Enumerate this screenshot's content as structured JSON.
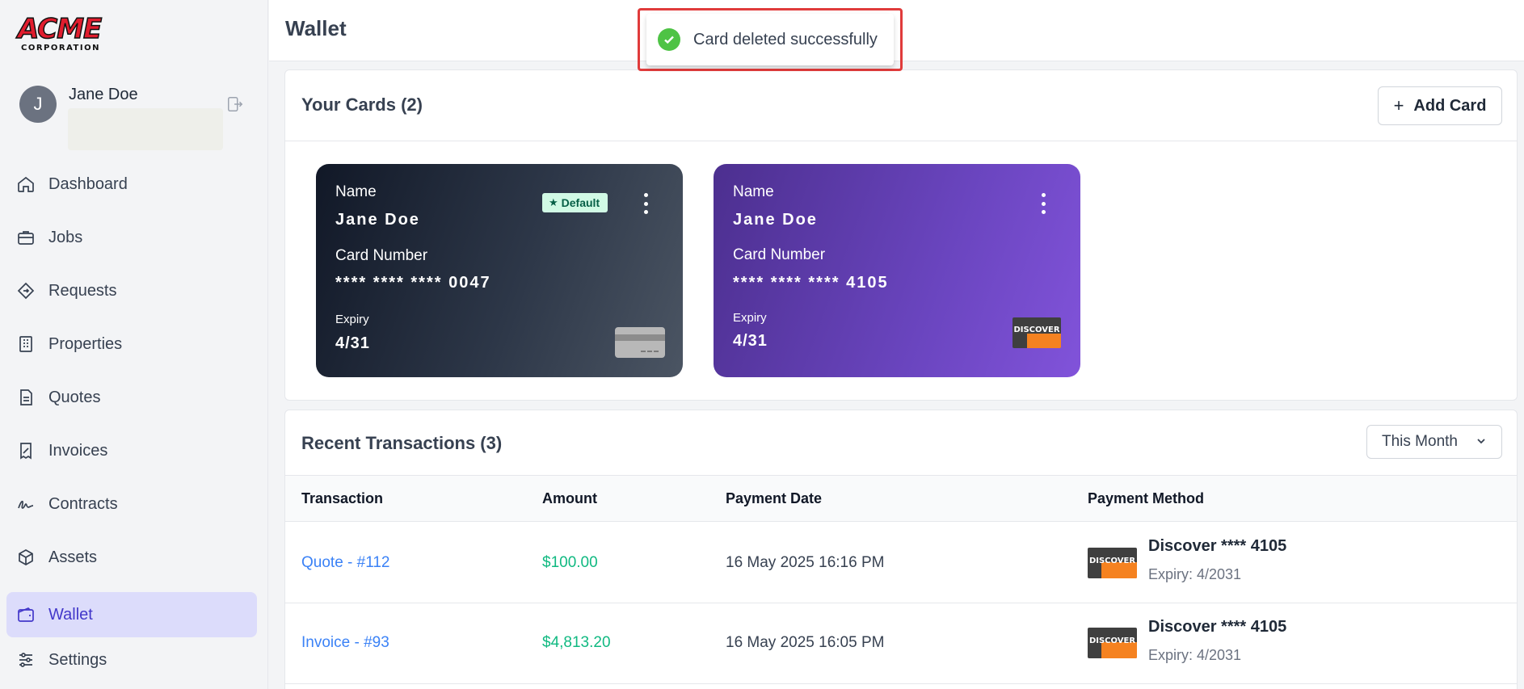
{
  "sidebar": {
    "logo": {
      "line1": "ACME",
      "line2": "CORPORATION"
    },
    "user": {
      "initial": "J",
      "name": "Jane Doe"
    },
    "items": [
      {
        "label": "Dashboard",
        "icon": "home-icon"
      },
      {
        "label": "Jobs",
        "icon": "briefcase-icon"
      },
      {
        "label": "Requests",
        "icon": "diamond-icon"
      },
      {
        "label": "Properties",
        "icon": "building-icon"
      },
      {
        "label": "Quotes",
        "icon": "document-icon"
      },
      {
        "label": "Invoices",
        "icon": "receipt-icon"
      },
      {
        "label": "Contracts",
        "icon": "signature-icon"
      },
      {
        "label": "Assets",
        "icon": "cube-icon"
      },
      {
        "label": "Wallet",
        "icon": "wallet-icon"
      },
      {
        "label": "Settings",
        "icon": "sliders-icon"
      }
    ],
    "active": "Wallet"
  },
  "header": {
    "title": "Wallet"
  },
  "toast": {
    "message": "Card deleted successfully"
  },
  "cards_panel": {
    "title": "Your Cards (2)",
    "add_label": "Add Card",
    "cards": [
      {
        "name_label": "Name",
        "name": "Jane Doe",
        "number_label": "Card Number",
        "number": "**** **** **** 0047",
        "expiry_label": "Expiry",
        "expiry": "4/31",
        "badge": "Default",
        "brand": "generic-card-icon"
      },
      {
        "name_label": "Name",
        "name": "Jane Doe",
        "number_label": "Card Number",
        "number": "**** **** **** 4105",
        "expiry_label": "Expiry",
        "expiry": "4/31",
        "brand": "discover-logo",
        "brand_text": "DISCOVER"
      }
    ]
  },
  "transactions": {
    "title": "Recent Transactions (3)",
    "filter": "This Month",
    "columns": [
      "Transaction",
      "Amount",
      "Payment Date",
      "Payment Method"
    ],
    "rows": [
      {
        "transaction": "Quote - #112",
        "amount": "$100.00",
        "date": "16 May 2025 16:16 PM",
        "method": "Discover **** 4105",
        "expiry": "Expiry: 4/2031",
        "brand_text": "DISCOVER"
      },
      {
        "transaction": "Invoice - #93",
        "amount": "$4,813.20",
        "date": "16 May 2025 16:05 PM",
        "method": "Discover **** 4105",
        "expiry": "Expiry: 4/2031",
        "brand_text": "DISCOVER"
      }
    ]
  },
  "colors": {
    "accent": "#4338ca",
    "active_bg": "#dcdcfb",
    "link": "#3b82f6",
    "amount": "#10b981",
    "toast_outline": "#e03b3b",
    "success": "#4ec345"
  }
}
